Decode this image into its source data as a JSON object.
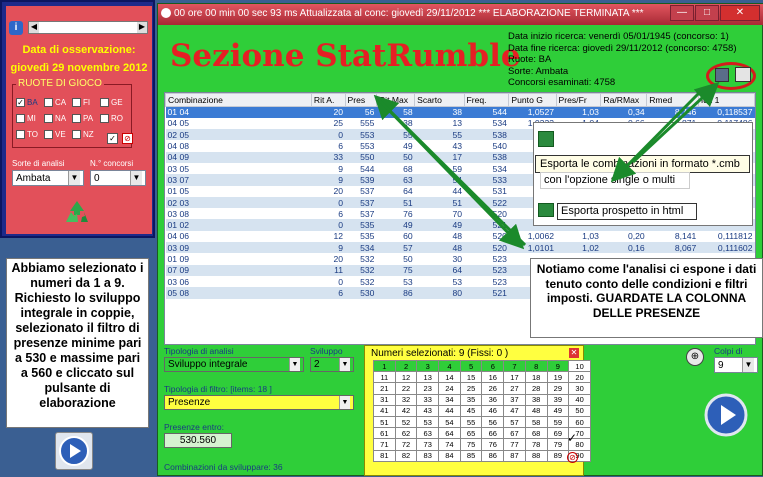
{
  "left_panel": {
    "search_value": "",
    "obs_label": "Data di osservazione:",
    "obs_date": "giovedì 29 novembre 2012",
    "ruote_title": "RUOTE DI GIOCO",
    "ruote": [
      {
        "label": "BA",
        "checked": true
      },
      {
        "label": "CA",
        "checked": false
      },
      {
        "label": "FI",
        "checked": false
      },
      {
        "label": "GE",
        "checked": false
      },
      {
        "label": "MI",
        "checked": false
      },
      {
        "label": "NA",
        "checked": false
      },
      {
        "label": "PA",
        "checked": false
      },
      {
        "label": "RO",
        "checked": false
      },
      {
        "label": "TO",
        "checked": false
      },
      {
        "label": "VE",
        "checked": false
      },
      {
        "label": "NZ",
        "checked": false
      }
    ],
    "sorte_label": "Sorte di analisi",
    "sorte_value": "Ambata",
    "concorsi_label": "N.° concorsi",
    "concorsi_value": "0",
    "note": "Abbiamo selezionato i numeri da 1 a 9. Richiesto lo sviluppo integrale in coppie, selezionato il filtro di presenze minime pari a 530 e massime pari a 560 e cliccato sul pulsante di elaborazione"
  },
  "window": {
    "title": "00 ore 00 min 00 sec 93 ms   Attualizzata al conc: giovedì 29/11/2012 *** ELABORAZIONE TERMINATA ***",
    "app_title": "Sezione StatRumble",
    "info": [
      "Data inizio ricerca: venerdì 05/01/1945  (concorso: 1)",
      "Data fine ricerca: giovedì 29/11/2012   (concorso: 4758)",
      "Ruote: BA",
      "Sorte: Ambata",
      "Concorsi esaminati: 4758"
    ]
  },
  "table": {
    "headers": [
      "Combinazione",
      "Rit A.",
      "Pres",
      "Rit Max",
      "Scarto",
      "Freq.",
      "Punto G",
      "Pres/Fr",
      "Ra/RMax",
      "Rmed",
      "Idx 1"
    ],
    "rows": [
      [
        "01 04",
        "20",
        "56",
        "58",
        "38",
        "544",
        "1,0527",
        "1,03",
        "0,34",
        "8,746",
        "0,118537"
      ],
      [
        "04 05",
        "25",
        "555",
        "38",
        "13",
        "534",
        "1,0333",
        "1,04",
        "0,66",
        "8,871",
        "0,117486"
      ],
      [
        "02 05",
        "0",
        "553",
        "55",
        "55",
        "538",
        "",
        "",
        "",
        "",
        ""
      ],
      [
        "04 08",
        "6",
        "553",
        "49",
        "43",
        "540",
        "",
        "",
        "",
        "",
        ""
      ],
      [
        "04 09",
        "33",
        "550",
        "50",
        "17",
        "538",
        "",
        "",
        "",
        "",
        ""
      ],
      [
        "03 05",
        "9",
        "544",
        "68",
        "59",
        "534",
        "",
        "",
        "",
        "",
        ""
      ],
      [
        "03 07",
        "9",
        "539",
        "63",
        "54",
        "533",
        "",
        "",
        "",
        "",
        ""
      ],
      [
        "01 05",
        "20",
        "537",
        "64",
        "44",
        "531",
        "",
        "",
        "",
        "",
        ""
      ],
      [
        "02 03",
        "0",
        "537",
        "51",
        "51",
        "522",
        "",
        "",
        "",
        "",
        ""
      ],
      [
        "03 08",
        "6",
        "537",
        "76",
        "70",
        "520",
        "",
        "",
        "",
        "",
        ""
      ],
      [
        "01 02",
        "0",
        "535",
        "49",
        "49",
        "521",
        "",
        "",
        "",
        "",
        ""
      ],
      [
        "04 06",
        "12",
        "535",
        "60",
        "48",
        "520",
        "1,0062",
        "1,03",
        "0,20",
        "8,141",
        "0,111812"
      ],
      [
        "03 09",
        "9",
        "534",
        "57",
        "48",
        "520",
        "1,0101",
        "1,02",
        "0,16",
        "8,067",
        "0,111602"
      ],
      [
        "01 09",
        "20",
        "532",
        "50",
        "30",
        "523",
        "",
        "",
        "",
        "",
        ""
      ],
      [
        "07 09",
        "11",
        "532",
        "75",
        "64",
        "523",
        "",
        "",
        "",
        "",
        ""
      ],
      [
        "03 06",
        "0",
        "532",
        "53",
        "53",
        "523",
        "",
        "",
        "",
        "",
        ""
      ],
      [
        "05 08",
        "6",
        "530",
        "86",
        "80",
        "521",
        "",
        "",
        "",
        "",
        ""
      ]
    ]
  },
  "lower": {
    "tipologia_label": "Tipologia di analisi",
    "tipologia_value": "Sviluppo integrale",
    "sviluppo_label": "Sviluppo",
    "sviluppo_value": "2",
    "filtro_label": "Tipologia di filtro: [items: 18 ]",
    "filtro_value": "Presenze",
    "presenze_label": "Presenze entro:",
    "presenze_value": "530.560",
    "combinazioni_label": "Combinazioni da sviluppare: 36",
    "numeri_title": "Numeri selezionati: 9 (Fissi: 0 )",
    "colpi_label": "Colpi di gioco",
    "colpi_value": "9"
  },
  "popup": {
    "export_cmb": "Esporta le combinazioni in formato *.cmb",
    "option": "con l'opzione single o multi",
    "export_html": "Esporta prospetto in html"
  },
  "yellow_note": "Notiamo come l'analisi ci espone i dati tenuto conto delle condizioni e filtri imposti. GUARDATE LA COLONNA DELLE PRESENZE"
}
